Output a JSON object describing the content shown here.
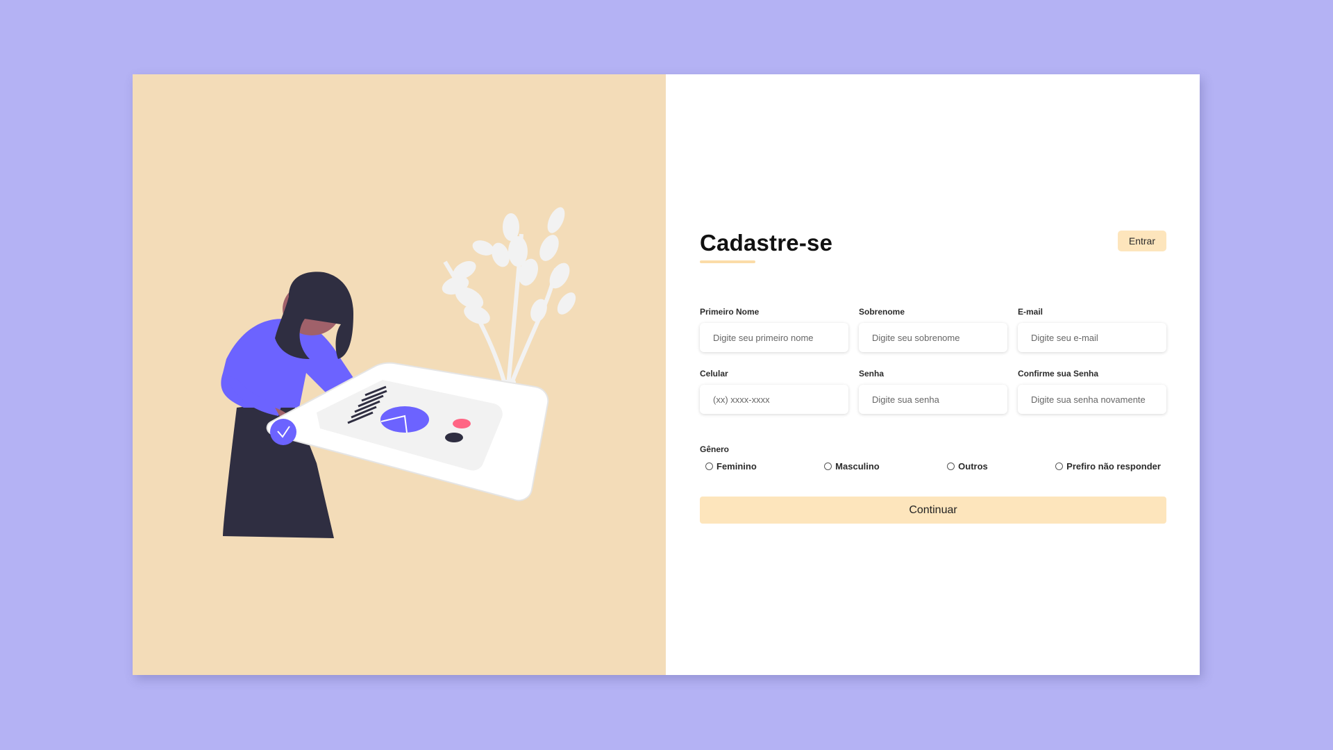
{
  "header": {
    "title": "Cadastre-se",
    "login_label": "Entrar"
  },
  "fields": [
    {
      "label": "Primeiro Nome",
      "placeholder": "Digite seu primeiro nome",
      "value": ""
    },
    {
      "label": "Sobrenome",
      "placeholder": "Digite seu sobrenome",
      "value": ""
    },
    {
      "label": "E-mail",
      "placeholder": "Digite seu e-mail",
      "value": ""
    },
    {
      "label": "Celular",
      "placeholder": "(xx) xxxx-xxxx",
      "value": ""
    },
    {
      "label": "Senha",
      "placeholder": "Digite sua senha",
      "value": ""
    },
    {
      "label": "Confirme sua Senha",
      "placeholder": "Digite sua senha novamente",
      "value": ""
    }
  ],
  "gender": {
    "label": "Gênero",
    "options": [
      {
        "label": "Feminino",
        "selected": false
      },
      {
        "label": "Masculino",
        "selected": false
      },
      {
        "label": "Outros",
        "selected": false
      },
      {
        "label": "Prefiro não responder",
        "selected": false
      }
    ]
  },
  "submit": {
    "label": "Continuar"
  },
  "colors": {
    "page_background": "#b4b2f4",
    "illustration_panel": "#f3dcb8",
    "accent": "#fde5bc",
    "figure_primary": "#6c63ff",
    "figure_dark": "#2f2e41",
    "skin": "#a0616a",
    "plant": "#f2f2f2",
    "dot_red": "#ff6584"
  }
}
